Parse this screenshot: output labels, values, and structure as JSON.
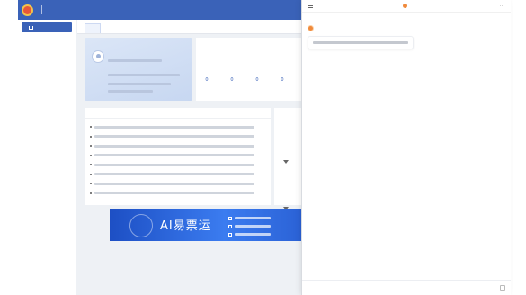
{
  "header": {
    "brand_name": "",
    "brand_sub": "",
    "portal_label": ""
  },
  "sidebar": {
    "items": [
      {
        "label": ""
      },
      {
        "label": ""
      },
      {
        "label": ""
      },
      {
        "label": ""
      },
      {
        "label": ""
      },
      {
        "label": ""
      },
      {
        "label": ""
      },
      {
        "label": ""
      }
    ]
  },
  "tabs": [
    {
      "label": ""
    }
  ],
  "profile": {
    "name": ""
  },
  "info": {
    "headline_prefix": "",
    "headline_link": "",
    "date": "",
    "stats": [
      {
        "num": "0",
        "label": ""
      },
      {
        "num": "0",
        "label": ""
      },
      {
        "num": "0",
        "label": ""
      },
      {
        "num": "0",
        "label": ""
      }
    ]
  },
  "notices": {
    "title": "",
    "more_label": "",
    "rows": [
      {
        "tag": ""
      },
      {
        "tag": ""
      },
      {
        "tag": ""
      },
      {
        "tag": ""
      },
      {
        "tag": ""
      },
      {
        "tag": ""
      },
      {
        "tag": ""
      },
      {
        "tag": ""
      }
    ]
  },
  "banner": {
    "title": "AI易票运"
  },
  "footer": {
    "text": ""
  },
  "chat": {
    "title": "",
    "more_label": "···",
    "input_placeholder": ""
  }
}
